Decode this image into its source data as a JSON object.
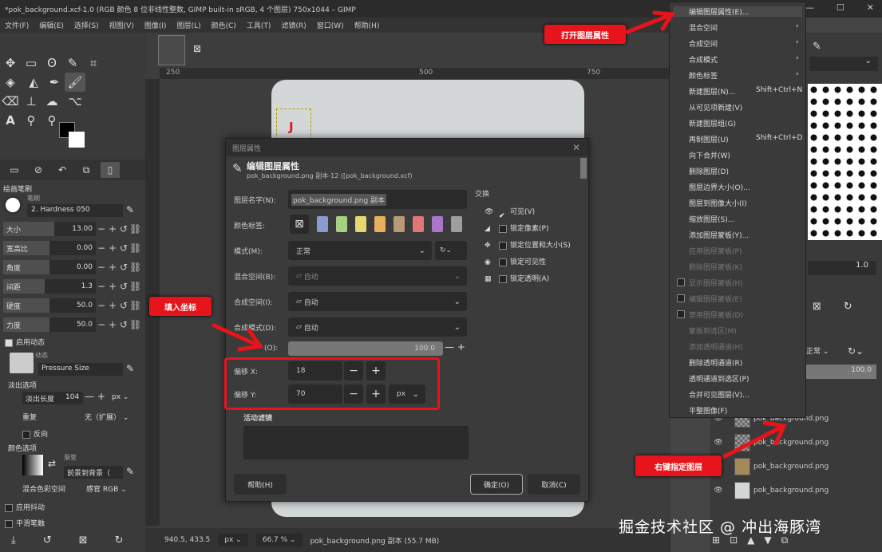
{
  "window": {
    "title": "*pok_background.xcf-1.0 (RGB 颜色 8 位非线性整数, GIMP built-in sRGB, 4 个图层) 750x1044 – GIMP",
    "controls": [
      "—",
      "☐",
      "✕"
    ]
  },
  "menubar": [
    "文件(F)",
    "编辑(E)",
    "选择(S)",
    "视图(V)",
    "图像(I)",
    "图层(L)",
    "颜色(C)",
    "工具(T)",
    "滤镜(R)",
    "窗口(W)",
    "帮助(H)"
  ],
  "tool_options": {
    "section_title": "绘画笔刷",
    "brush_label": "笔刷",
    "brush_name": "2. Hardness 050",
    "sliders": [
      {
        "label": "大小",
        "value": "13.00",
        "fill": 0.55
      },
      {
        "label": "宽高比",
        "value": "0.00",
        "fill": 0.5
      },
      {
        "label": "角度",
        "value": "0.00",
        "fill": 0.5
      },
      {
        "label": "间距",
        "value": "1.3",
        "fill": 0.45
      },
      {
        "label": "硬度",
        "value": "50.0",
        "fill": 0.5
      },
      {
        "label": "力度",
        "value": "50.0",
        "fill": 0.5
      }
    ],
    "dynamics_check": "启用动态",
    "dynamics_label": "动态",
    "dynamics_name": "Pressure Size",
    "fade_section": "淡出选项",
    "fade_length_label": "淡出长度",
    "fade_length_value": "104",
    "fade_unit": "px",
    "repeat_label": "重复",
    "repeat_value": "无（扩展）",
    "reverse_label": "反向",
    "color_section": "颜色选项",
    "gradient_label": "渐变",
    "gradient_name": "前景到背景（",
    "blend_space_label": "混合色彩空间",
    "blend_space_value": "感官 RGB",
    "jitter_label": "应用抖动",
    "smooth_label": "平滑笔触"
  },
  "ruler": {
    "marks": [
      "250",
      "500",
      "750"
    ]
  },
  "statusbar": {
    "coords": "940.5, 433.5",
    "unit": "px",
    "zoom": "66.7 %",
    "info": "pok_background.png 副本 (55.7 MB)"
  },
  "dialog": {
    "window_title": "图层属性",
    "heading": "编辑图层属性",
    "subheading": "pok_background.png 副本-12 ([pok_background.xcf)",
    "name_label": "图层名字(N):",
    "name_value": "pok_background.png 副本",
    "color_tag_label": "颜色标签:",
    "color_tags": [
      "#8a9bd4",
      "#a8cf82",
      "#e3d96e",
      "#e6b05c",
      "#b79a76",
      "#e07676",
      "#a877c7",
      "#9e9e9e"
    ],
    "mode_label": "模式(M):",
    "mode_value": "正常",
    "blend_space_label": "混合空间(B):",
    "blend_space_value": "自动",
    "composite_space_label": "合成空间(I):",
    "composite_space_value": "自动",
    "composite_mode_label": "合成模式(D):",
    "composite_mode_value": "自动",
    "opacity_label": "(O):",
    "opacity_value": "100.0",
    "offset_x_label": "偏移 X:",
    "offset_x_value": "18",
    "offset_y_label": "偏移 Y:",
    "offset_y_value": "70",
    "offset_unit": "px",
    "switch_title": "交换",
    "switches": [
      {
        "label": "可见(V)",
        "checked": true
      },
      {
        "label": "锁定像素(P)",
        "checked": false
      },
      {
        "label": "锁定位置和大小(S)",
        "checked": false
      },
      {
        "label": "锁定可见性",
        "checked": false
      },
      {
        "label": "锁定透明(A)",
        "checked": false
      }
    ],
    "filters_label": "活动滤镜",
    "help_button": "帮助(H)",
    "ok_button": "确定(O)",
    "cancel_button": "取消(C)"
  },
  "context_menu": {
    "items": [
      {
        "label": "编辑图层属性(E)...",
        "shortcut": "",
        "sub": false,
        "disabled": false,
        "check": false
      },
      {
        "label": "混合空间",
        "shortcut": "",
        "sub": true,
        "disabled": false,
        "check": false
      },
      {
        "label": "合成空间",
        "shortcut": "",
        "sub": true,
        "disabled": false,
        "check": false
      },
      {
        "label": "合成模式",
        "shortcut": "",
        "sub": true,
        "disabled": false,
        "check": false
      },
      {
        "label": "颜色标签",
        "shortcut": "",
        "sub": true,
        "disabled": false,
        "check": false
      },
      {
        "label": "新建图层(N)...",
        "shortcut": "Shift+Ctrl+N",
        "sub": false,
        "disabled": false,
        "check": false
      },
      {
        "label": "从可见项新建(V)",
        "shortcut": "",
        "sub": false,
        "disabled": false,
        "check": false
      },
      {
        "label": "新建图层组(G)",
        "shortcut": "",
        "sub": false,
        "disabled": false,
        "check": false
      },
      {
        "label": "再制图层(U)",
        "shortcut": "Shift+Ctrl+D",
        "sub": false,
        "disabled": false,
        "check": false
      },
      {
        "label": "向下合并(W)",
        "shortcut": "",
        "sub": false,
        "disabled": false,
        "check": false
      },
      {
        "label": "删除图层(D)",
        "shortcut": "",
        "sub": false,
        "disabled": false,
        "check": false
      },
      {
        "label": "图层边界大小(O)...",
        "shortcut": "",
        "sub": false,
        "disabled": false,
        "check": false
      },
      {
        "label": "图层到图像大小(I)",
        "shortcut": "",
        "sub": false,
        "disabled": false,
        "check": false
      },
      {
        "label": "缩放图层(S)...",
        "shortcut": "",
        "sub": false,
        "disabled": false,
        "check": false
      },
      {
        "label": "添加图层蒙板(Y)...",
        "shortcut": "",
        "sub": false,
        "disabled": false,
        "check": false
      },
      {
        "label": "应用图层蒙板(P)",
        "shortcut": "",
        "sub": false,
        "disabled": true,
        "check": false
      },
      {
        "label": "删除图层蒙板(K)",
        "shortcut": "",
        "sub": false,
        "disabled": true,
        "check": false
      },
      {
        "label": "显示图层蒙板(H)",
        "shortcut": "",
        "sub": false,
        "disabled": true,
        "check": true
      },
      {
        "label": "编辑图层蒙板(E)",
        "shortcut": "",
        "sub": false,
        "disabled": true,
        "check": true
      },
      {
        "label": "禁用图层蒙板(D)",
        "shortcut": "",
        "sub": false,
        "disabled": true,
        "check": true
      },
      {
        "label": "蒙板到选区(M)",
        "shortcut": "",
        "sub": false,
        "disabled": true,
        "check": false
      },
      {
        "label": "添加透明通道(H)",
        "shortcut": "",
        "sub": false,
        "disabled": true,
        "check": false
      },
      {
        "label": "删除透明通道(R)",
        "shortcut": "",
        "sub": false,
        "disabled": false,
        "check": false
      },
      {
        "label": "透明通道到选区(P)",
        "shortcut": "",
        "sub": false,
        "disabled": false,
        "check": false
      },
      {
        "label": "合并可见图层(V)...",
        "shortcut": "",
        "sub": false,
        "disabled": false,
        "check": false
      },
      {
        "label": "平整图像(F)",
        "shortcut": "",
        "sub": false,
        "disabled": false,
        "check": false
      }
    ]
  },
  "layers_dock": {
    "mode_value": "正常",
    "opacity_value": "100.0",
    "scale_value": "1.0",
    "layers": [
      "pok_background.png",
      "pok_background.png",
      "pok_background.png",
      "pok_background.png"
    ]
  },
  "annotations": {
    "open_props": "打开图层属性",
    "fill_coords": "填入坐标",
    "right_click": "右键指定图层"
  },
  "watermark": "掘金技术社区 @ 冲出海豚湾"
}
